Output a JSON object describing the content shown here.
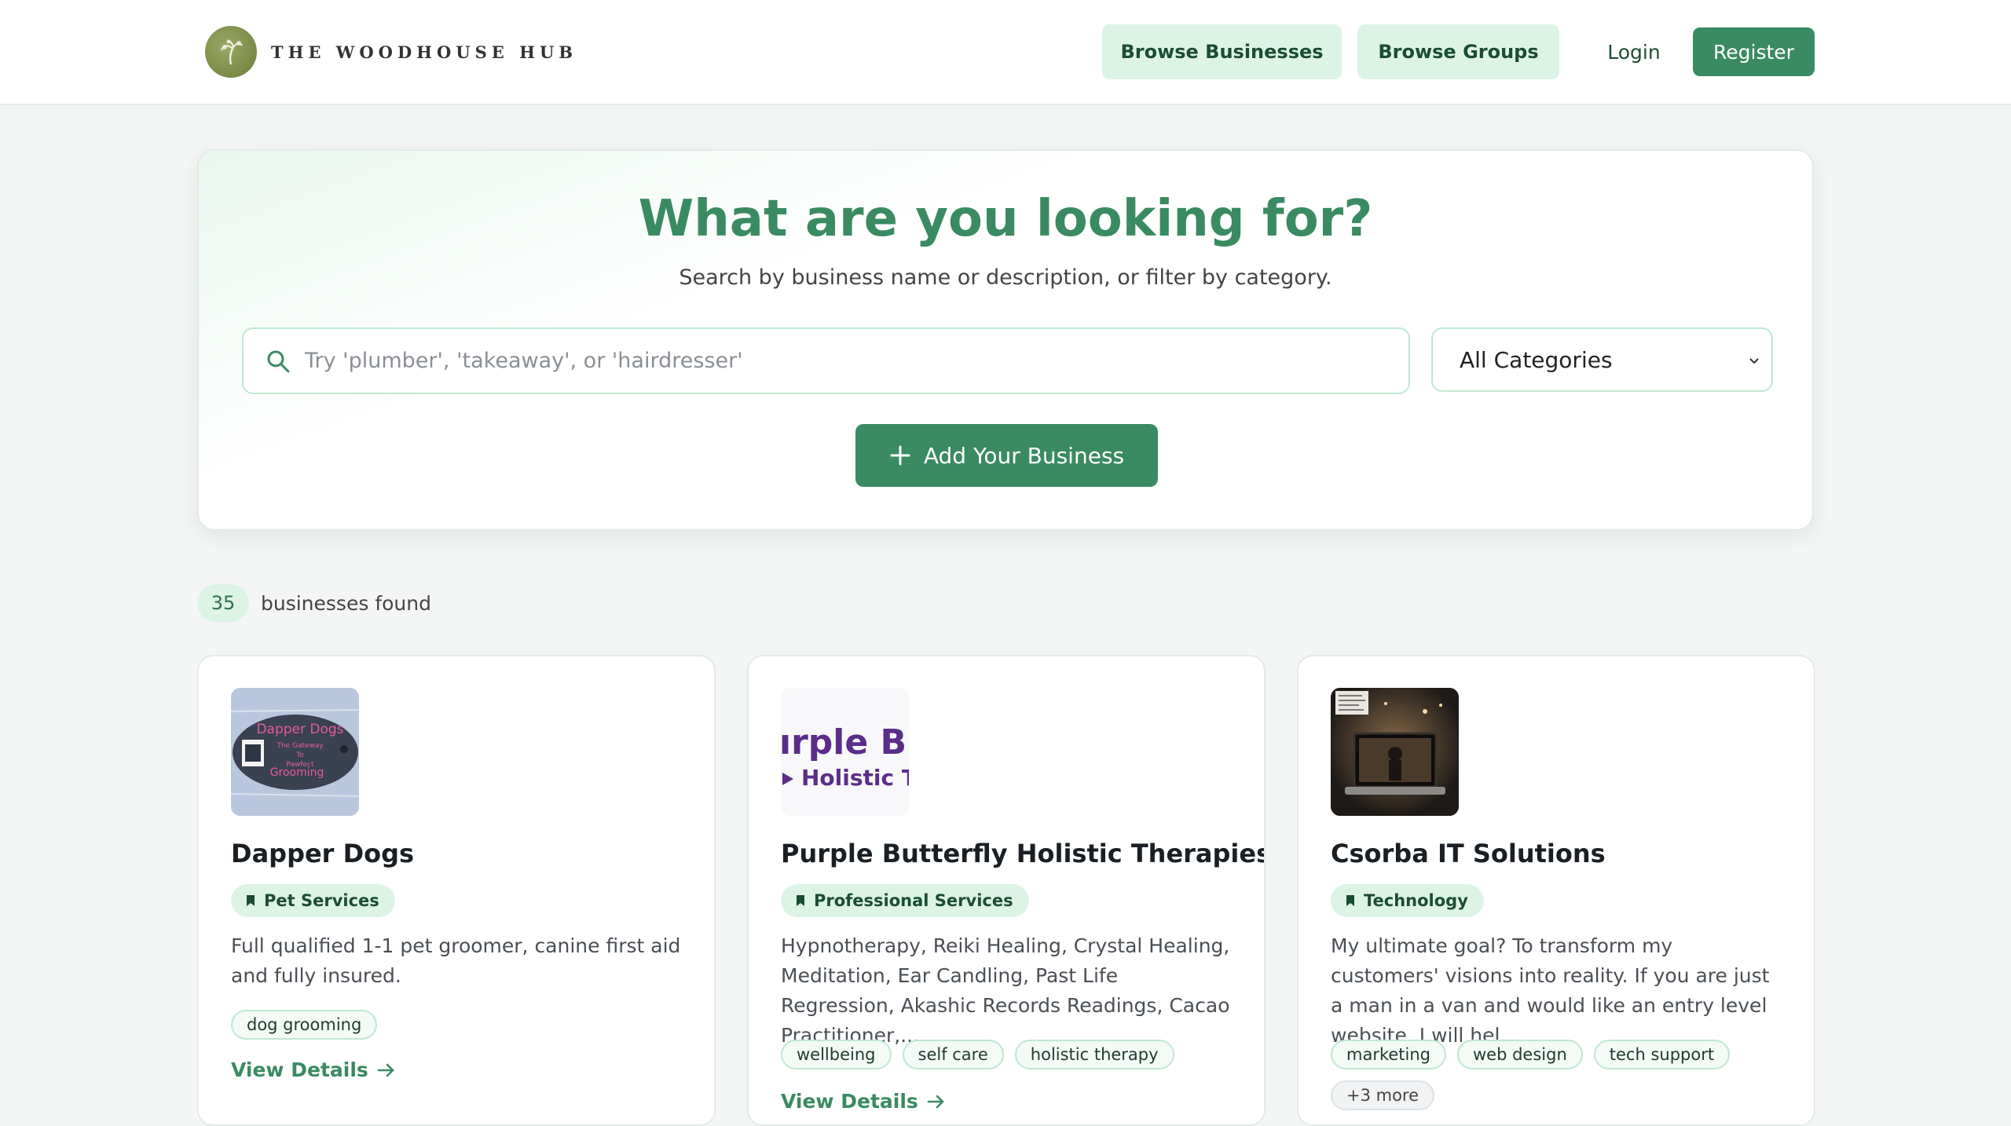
{
  "header": {
    "logo_text": "THE WOODHOUSE HUB",
    "nav": {
      "browse_businesses": "Browse Businesses",
      "browse_groups": "Browse Groups",
      "login": "Login",
      "register": "Register"
    }
  },
  "hero": {
    "title": "What are you looking for?",
    "subtitle": "Search by business name or description, or filter by category.",
    "search_placeholder": "Try 'plumber', 'takeaway', or 'hairdresser'",
    "category_selected": "All Categories",
    "add_button": "Add Your Business"
  },
  "results": {
    "count": "35",
    "label": "businesses found",
    "view_details": "View Details",
    "cards": [
      {
        "name": "Dapper Dogs",
        "category": "Pet Services",
        "description": "Full qualified 1-1 pet groomer, canine first aid and fully insured.",
        "tags": [
          "dog grooming"
        ],
        "thumb_text": [
          "Dapper Dogs",
          "The Gateway",
          "To",
          "Pawfect",
          "Grooming"
        ]
      },
      {
        "name": "Purple Butterfly Holistic Therapies",
        "category": "Professional Services",
        "description": "Hypnotherapy, Reiki Healing, Crystal Healing, Meditation, Ear Candling, Past Life Regression, Akashic Records Readings, Cacao Practitioner,...",
        "tags": [
          "wellbeing",
          "self care",
          "holistic therapy"
        ],
        "thumb_text": [
          "ırple Bu",
          "Holistic Th"
        ]
      },
      {
        "name": "Csorba IT Solutions",
        "category": "Technology",
        "description": "My ultimate goal? To transform my customers' visions into reality. If you are just a man in a van and would like an entry level website, I will hel...",
        "tags": [
          "marketing",
          "web design",
          "tech support"
        ],
        "more_tags": "+3 more"
      }
    ]
  },
  "colors": {
    "accent": "#3a8a62",
    "accent_light": "#dcf4e6",
    "page_bg": "#f4f6f5"
  },
  "icons": {
    "search": "search-icon",
    "plus": "plus-icon",
    "category": "bookmark-icon",
    "arrow": "arrow-right-icon",
    "chevron": "chevron-down-icon"
  }
}
